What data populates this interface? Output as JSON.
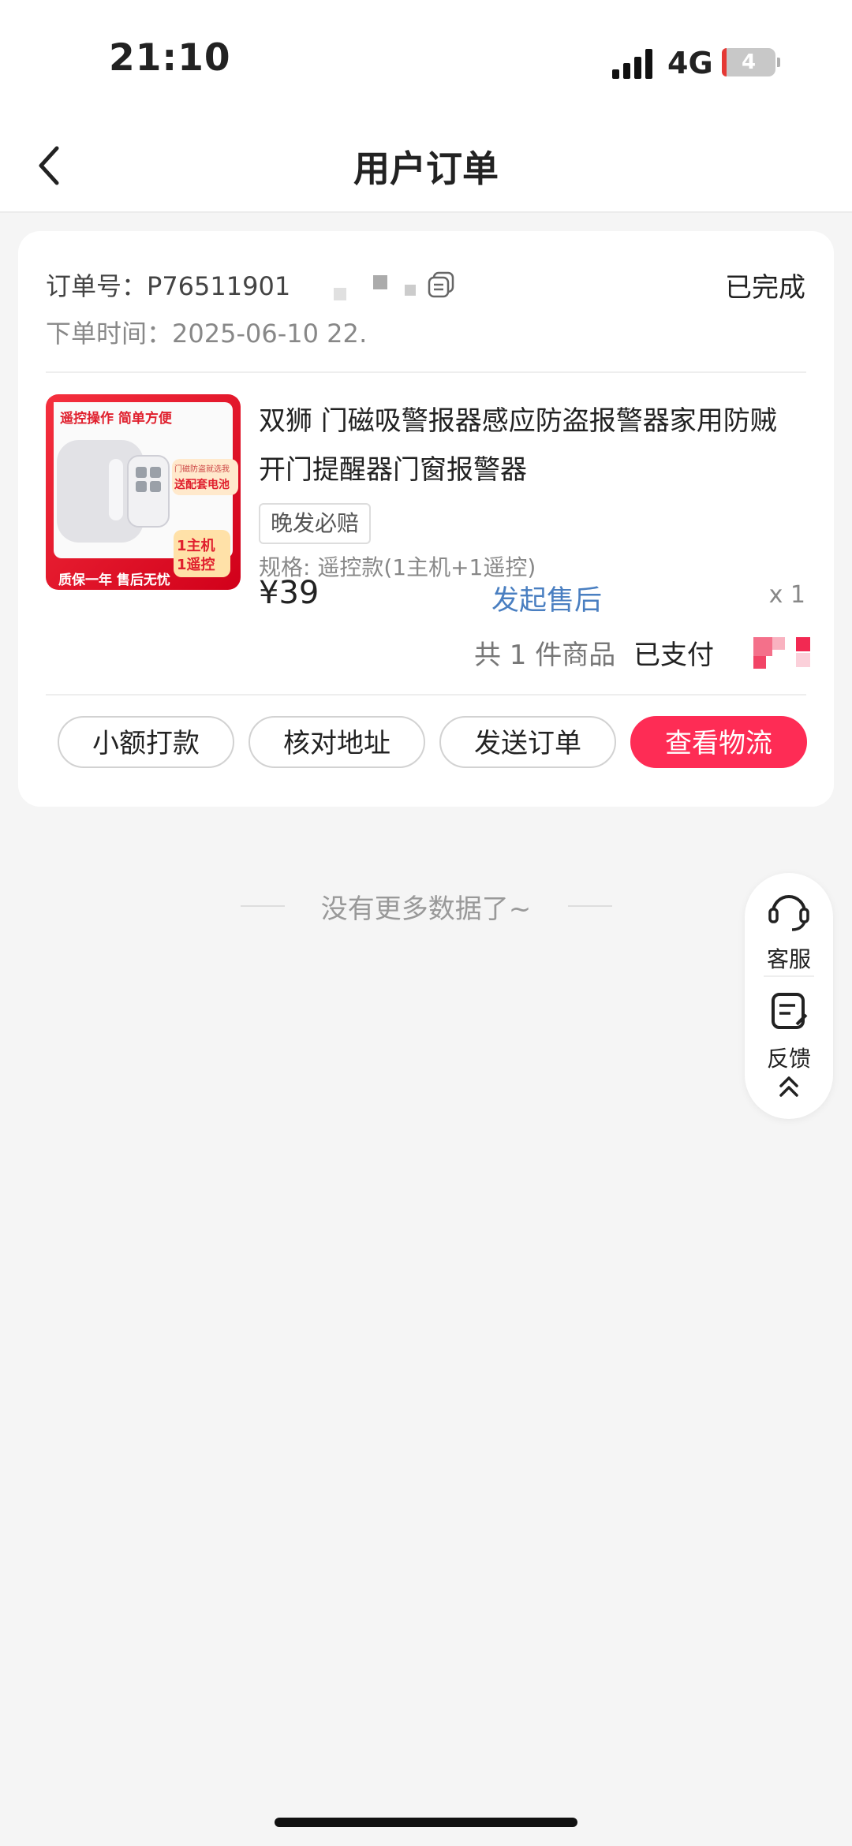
{
  "status_bar": {
    "time": "21:10",
    "network": "4G",
    "battery": "4"
  },
  "header": {
    "title": "用户订单"
  },
  "order": {
    "order_no_label": "订单号：",
    "order_no": "P765119012…",
    "order_time_label": "下单时间：",
    "order_time": "2025-06-10 22…",
    "status": "已完成",
    "product": {
      "title": "双狮 门磁吸警报器感应防盗报警器家用防贼开门提醒器门窗报警器",
      "tag": "晚发必赔",
      "spec": "规格: 遥控款(1主机+1遥控)",
      "price": "¥39",
      "after_sale": "发起售后",
      "quantity": "x 1",
      "image_texts": {
        "top_banner": "遥控操作 简单方便",
        "side_badge_1": "门磁防盗就选我",
        "side_badge_2": "送配套电池",
        "kit_1": "1主机",
        "kit_2": "1遥控",
        "bottom_banner": "质保一年 售后无忧"
      }
    },
    "total_count": "共 1 件商品",
    "paid_label": "已支付",
    "buttons": {
      "small_payment": "小额打款",
      "verify_address": "核对地址",
      "send_order": "发送订单",
      "view_logistics": "查看物流"
    }
  },
  "footer": {
    "no_more": "没有更多数据了~"
  },
  "float_panel": {
    "service": "客服",
    "feedback": "反馈"
  },
  "colors": {
    "accent": "#fe2c55",
    "link": "#4a7fc1",
    "background": "#f5f5f5"
  }
}
